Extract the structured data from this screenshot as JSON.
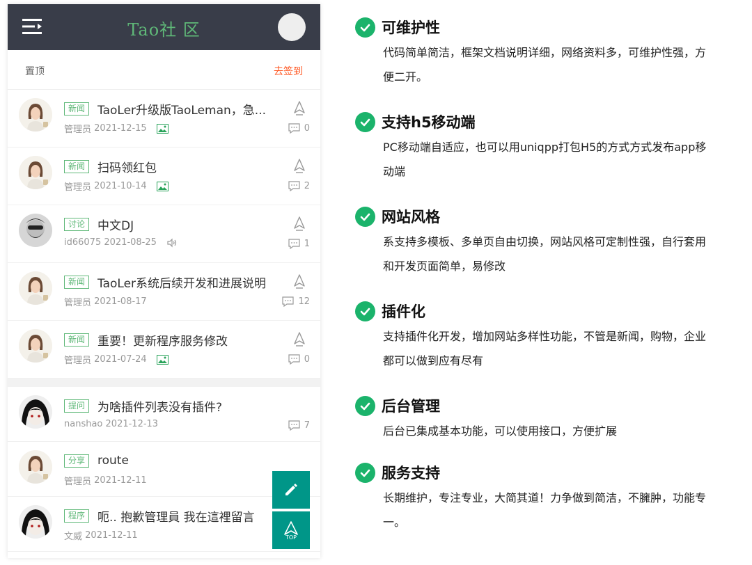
{
  "app": {
    "title": "Tao社 区"
  },
  "pinned": {
    "title": "置顶",
    "sign_in": "去签到",
    "posts": [
      {
        "tag": "新闻",
        "title": "TaoLer升级版TaoLeman，急...",
        "author": "管理员",
        "date": "2021-12-15",
        "extra": "image-icon",
        "comments": "0",
        "avatar": "woman-photo"
      },
      {
        "tag": "新闻",
        "title": "扫码领红包",
        "author": "管理员",
        "date": "2021-10-14",
        "extra": "image-icon",
        "comments": "2",
        "avatar": "woman-photo"
      },
      {
        "tag": "讨论",
        "title": "中文DJ",
        "author": "id66075",
        "date": "2021-08-25",
        "extra": "audio-icon",
        "comments": "1",
        "avatar": "bearded-man-photo"
      },
      {
        "tag": "新闻",
        "title": "TaoLer系统后续开发和进展说明",
        "author": "管理员",
        "date": "2021-08-17",
        "extra": "",
        "comments": "12",
        "avatar": "woman-photo"
      },
      {
        "tag": "新闻",
        "title": "重要！更新程序服务修改",
        "author": "管理员",
        "date": "2021-07-24",
        "extra": "image-icon",
        "comments": "0",
        "avatar": "woman-photo"
      }
    ]
  },
  "latest": [
    {
      "tag": "提问",
      "title": "为啥插件列表没有插件?",
      "author": "nanshao",
      "date": "2021-12-13",
      "comments": "7",
      "avatar": "anime-avatar"
    },
    {
      "tag": "分享",
      "title": "route",
      "author": "管理员",
      "date": "2021-12-11",
      "comments": "",
      "avatar": "woman-photo"
    },
    {
      "tag": "程序",
      "title": "呃.. 抱歉管理員 我在這裡留言",
      "author": "文威",
      "date": "2021-12-11",
      "comments": "",
      "avatar": "anime-avatar"
    }
  ],
  "fab": {
    "edit_icon": "pencil-icon",
    "top_label": "TOP"
  },
  "features": [
    {
      "title": "可维护性",
      "desc": [
        "代码简单简洁，框架文档说明详细，网络资料多，可维护性强，方",
        "便二开。"
      ]
    },
    {
      "title": "支持h5移动端",
      "desc": [
        "PC移动端自适应，也可以用uniqpp打包H5的方式方式发布app移",
        "动端"
      ]
    },
    {
      "title": "网站风格",
      "desc": [
        "系支持多模板、多单页自由切换，网站风格可定制性强，自行套用",
        "和开发页面简单，易修改"
      ]
    },
    {
      "title": "插件化",
      "desc": [
        "支持插件化开发，增加网站多样性功能，不管是新闻，购物，企业",
        "都可以做到应有尽有"
      ]
    },
    {
      "title": "后台管理",
      "desc": [
        "后台已集成基本功能，可以使用接口，方便扩展"
      ]
    },
    {
      "title": "服务支持",
      "desc": [
        "长期维护，专注专业，大简其道！力争做到简洁，不臃肿，功能专",
        "一。"
      ]
    }
  ],
  "colors": {
    "topbar": "#393d49",
    "accent_green": "#5fb878",
    "sign_in": "#ff5722",
    "fab": "#009688",
    "check": "#1bb36b"
  }
}
